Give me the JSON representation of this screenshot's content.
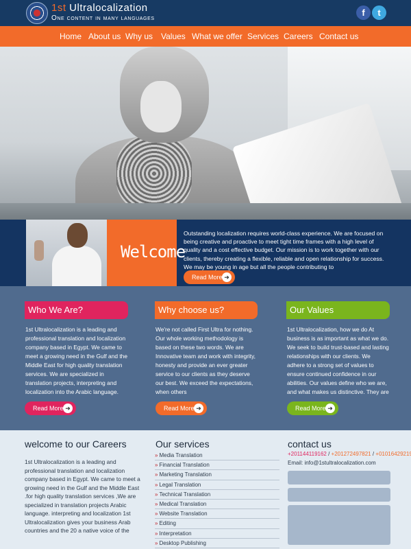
{
  "brand": {
    "title_num": "1st",
    "title_rest": " Ultralocalization",
    "tagline": "One content in many languages"
  },
  "social": {
    "facebook": "f",
    "twitter": "t"
  },
  "nav": [
    "Home",
    "About us",
    "Why  us",
    "Values",
    "What we offer",
    "Services",
    "Careers",
    "Contact us"
  ],
  "welcome": {
    "heading": "Welcome",
    "text": "Outstanding localization requires world-class experience. We are focused on being creative and proactive to meet tight time frames with a high level of quality and a cost effective budget. Our mission is to work together with our clients, thereby creating a flexible, reliable and open relationship for success. We may be young in age but all the people contributing to",
    "button": "Read More"
  },
  "cards": [
    {
      "title": "Who We Are?",
      "text": "1st Ultralocalization is a leading and professional translation and localization company based in Egypt. We came to meet a growing need in the Gulf and the Middle East for high quality translation services. We are specialized in translation projects, interpreting and localization into the Arabic language.",
      "button": "Read More"
    },
    {
      "title": "Why choose us?",
      "text": "We're not called First Ultra for nothing. Our whole working methodology is based on these two words. We are Innovative team and work with integrity, honesty and provide an ever greater service to our clients as they deserve our best. We exceed the expectations, when others",
      "button": "Read More"
    },
    {
      "title": "Our  Values",
      "text": "1st Ultralocalization, how we do At business is as important as what we do. We seek to build trust-based and lasting relationships with our clients. We adhere to a strong set of values to ensure continued confidence in our abilities. Our values define who we are, and what makes us distinctive. They are the fundamental",
      "button": "Read More"
    }
  ],
  "careers": {
    "title": "welcome to our  Careers",
    "text": "1st Ultralocalization is a leading and professional translation and localization company based in Egypt. We came to meet a growing need in the Gulf and the Middle East .for high quality translation services ,We are specialized in translation projects Arabic language. interpreting and localization 1st Ultralocalization gives your business Arab countries and the 20 a native voice of the"
  },
  "services": {
    "title": "Our services",
    "items": [
      "Media Translation",
      "Financial Translation",
      "Marketing Translation",
      "Legal Translation",
      "Technical Translation",
      "Medical Translation",
      "Website Translation",
      "Editing",
      "Interpretation",
      "Desktop Publishing"
    ]
  },
  "contact": {
    "title": "contact us",
    "phone1": "+201144119162",
    "phone2": "+201272497821",
    "phone3": "+01016429219",
    "separator": " / ",
    "email": "Email: info@1stultralocalization.com"
  },
  "colors": {
    "navy": "#173a63",
    "orange": "#f26b2a",
    "pink": "#e0245e",
    "green": "#7ab51d",
    "slate": "#506b8e"
  }
}
